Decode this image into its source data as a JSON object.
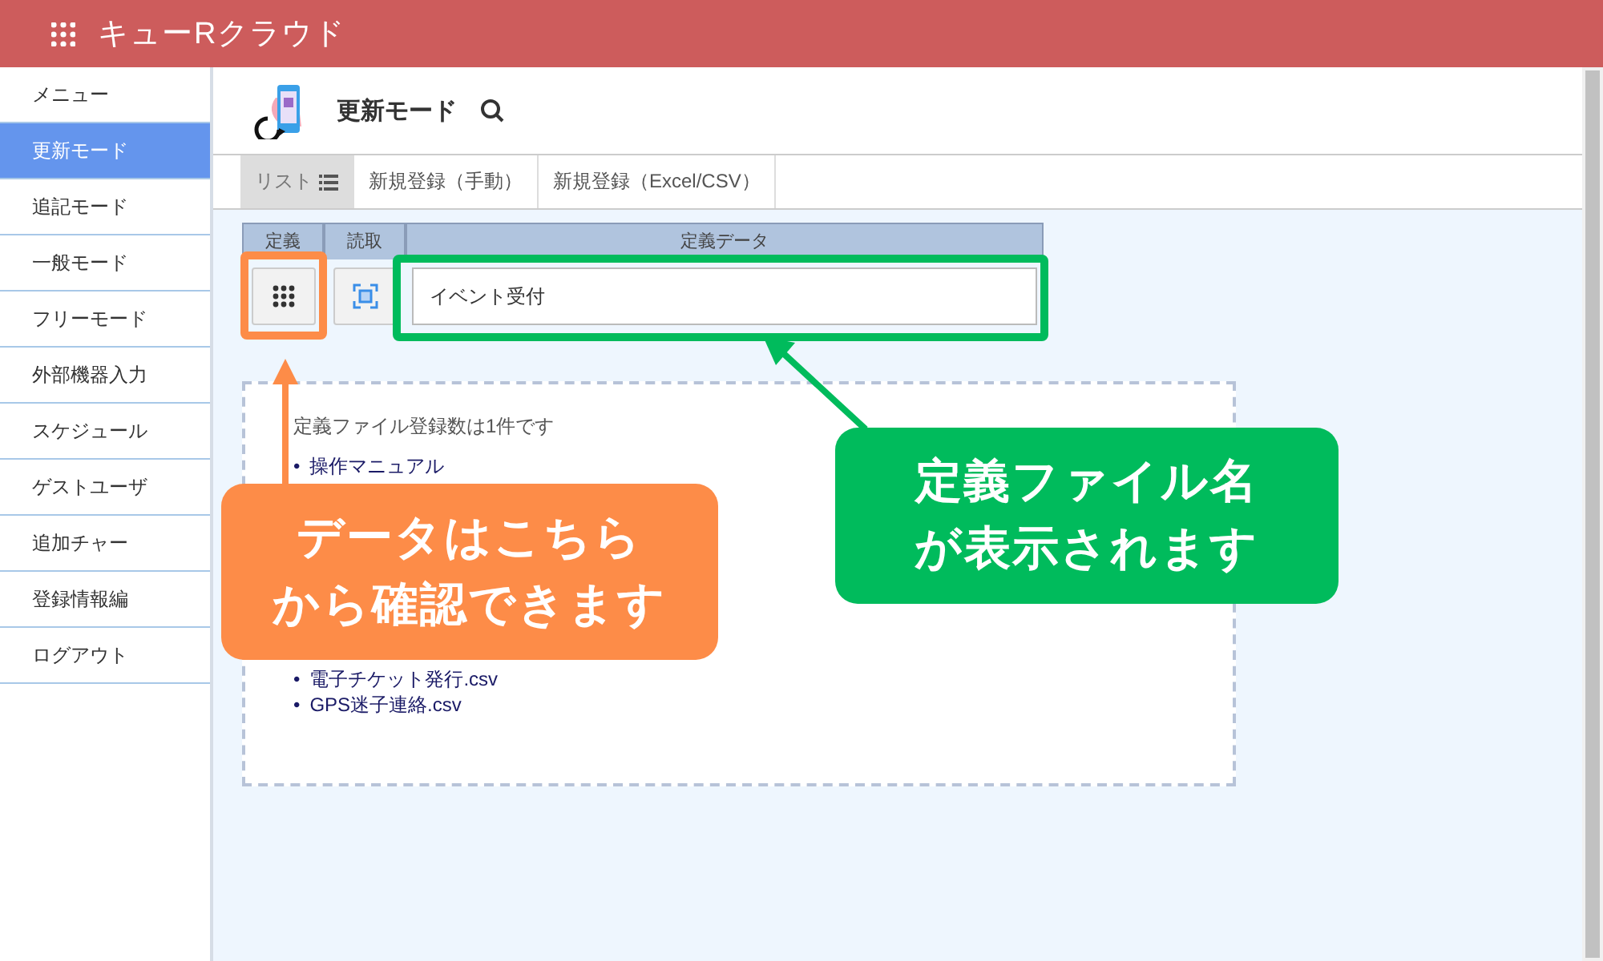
{
  "header": {
    "title": "キューRクラウド"
  },
  "sidebar": {
    "items": [
      {
        "label": "メニュー",
        "selected": false
      },
      {
        "label": "更新モード",
        "selected": true
      },
      {
        "label": "追記モード",
        "selected": false
      },
      {
        "label": "一般モード",
        "selected": false
      },
      {
        "label": "フリーモード",
        "selected": false
      },
      {
        "label": "外部機器入力",
        "selected": false
      },
      {
        "label": "スケジュール",
        "selected": false
      },
      {
        "label": "ゲストユーザ",
        "selected": false
      },
      {
        "label": "追加チャー",
        "selected": false
      },
      {
        "label": "登録情報編",
        "selected": false
      },
      {
        "label": "ログアウト",
        "selected": false
      }
    ]
  },
  "page": {
    "title": "更新モード"
  },
  "tabs": [
    {
      "label": "リスト",
      "selected": true
    },
    {
      "label": "新規登録（手動）",
      "selected": false
    },
    {
      "label": "新規登録（Excel/CSV）",
      "selected": false
    }
  ],
  "table": {
    "columns": [
      "定義",
      "読取",
      "定義データ"
    ],
    "value": "イベント受付"
  },
  "panel": {
    "message": "定義ファイル登録数は1件です",
    "files": [
      {
        "bullet": "•",
        "name": "操作マニュアル"
      },
      {
        "bullet": "•",
        "name": "電子チケット発行.csv"
      },
      {
        "bullet": "•",
        "name": "GPS迷子連絡.csv"
      }
    ]
  },
  "annotations": [
    {
      "lines": [
        "データはこちら",
        "から確認できます"
      ],
      "color": "#fd8c48"
    },
    {
      "lines": [
        "定義ファイル名",
        "が表示されます"
      ],
      "color": "#00bb5c"
    }
  ]
}
